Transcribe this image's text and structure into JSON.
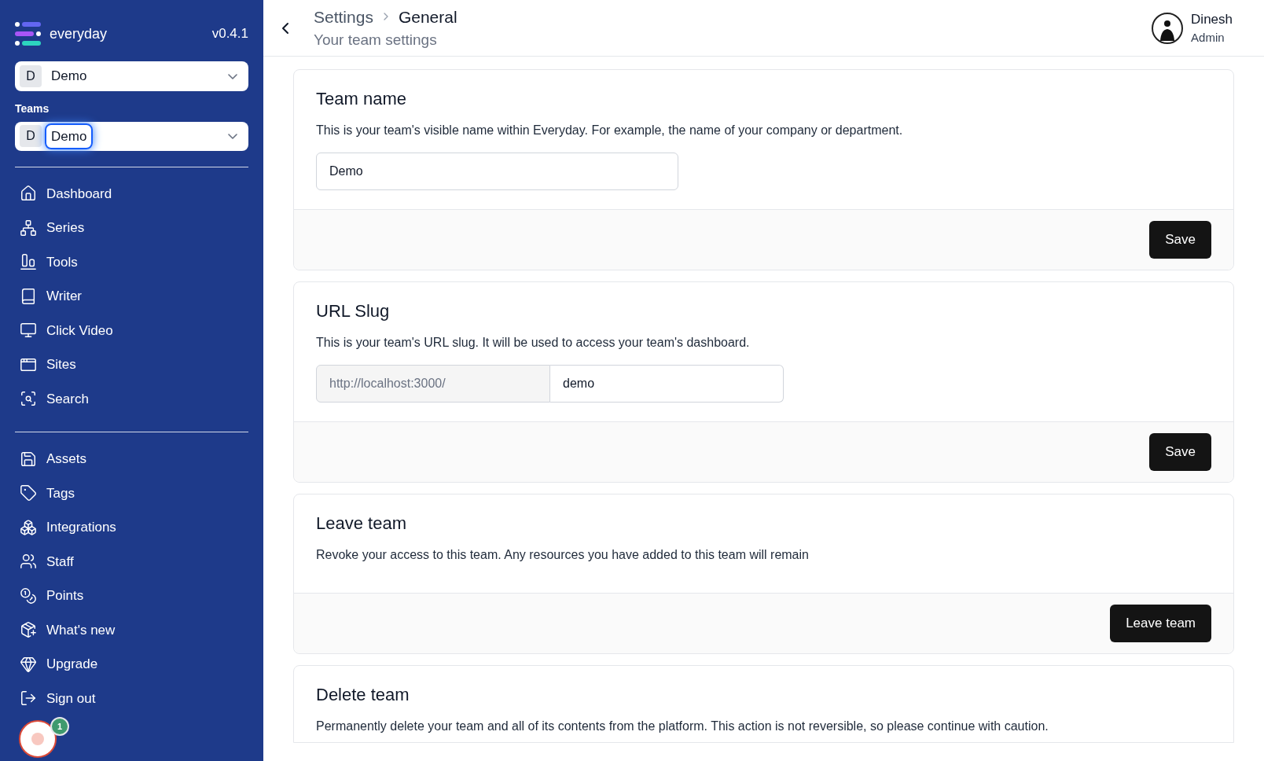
{
  "sidebar": {
    "app_name": "everyday",
    "version": "v0.4.1",
    "workspace_select": {
      "initial": "D",
      "value": "Demo"
    },
    "teams_label": "Teams",
    "team_select": {
      "initial": "D",
      "value": "Demo",
      "focused": true
    },
    "nav_groups": [
      [
        {
          "label": "Dashboard"
        },
        {
          "label": "Series"
        },
        {
          "label": "Tools"
        },
        {
          "label": "Writer"
        },
        {
          "label": "Click Video"
        },
        {
          "label": "Sites"
        },
        {
          "label": "Search"
        }
      ],
      [
        {
          "label": "Assets"
        },
        {
          "label": "Tags"
        },
        {
          "label": "Integrations"
        },
        {
          "label": "Staff"
        },
        {
          "label": "Points"
        }
      ]
    ],
    "footer_items": [
      {
        "label": "What's new"
      },
      {
        "label": "Upgrade"
      },
      {
        "label": "Sign out"
      }
    ]
  },
  "help_widget": {
    "badge": "1"
  },
  "header": {
    "breadcrumb": [
      "Settings",
      "General"
    ],
    "subtitle": "Your team settings",
    "user": {
      "name": "Dinesh",
      "role": "Admin"
    }
  },
  "cards": [
    {
      "kind": "text",
      "title": "Team name",
      "description": "This is your team's visible name within Everyday. For example, the name of your company or department.",
      "value": "Demo",
      "button": "Save"
    },
    {
      "kind": "slug",
      "title": "URL Slug",
      "description": "This is your team's URL slug. It will be used to access your team's dashboard.",
      "prefix": "http://localhost:3000/",
      "value": "demo",
      "button": "Save"
    },
    {
      "kind": "plain",
      "title": "Leave team",
      "description": "Revoke your access to this team. Any resources you have added to this team will remain",
      "button": "Leave team"
    },
    {
      "kind": "partial",
      "title": "Delete team",
      "description": "Permanently delete your team and all of its contents from the platform. This action is not reversible, so please continue with caution."
    }
  ]
}
